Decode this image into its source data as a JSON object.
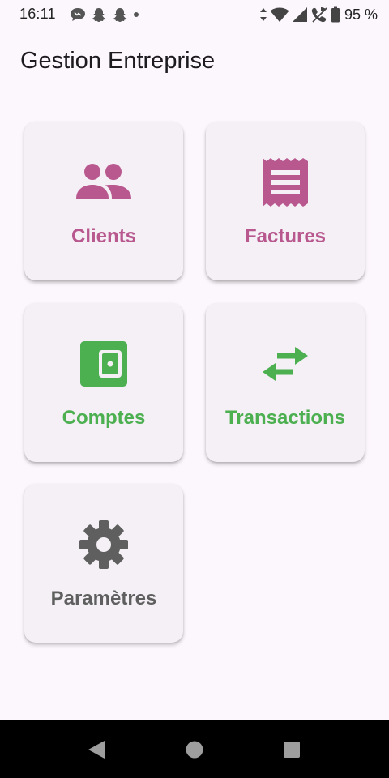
{
  "status_bar": {
    "time": "16:11",
    "battery": "95 %",
    "left_icons": [
      "chat-bubble-icon",
      "snapchat-ghost-icon",
      "snapchat-ghost-icon",
      "dot-icon"
    ],
    "right_icons": [
      "data-arrows-icon",
      "wifi-icon",
      "signal-icon",
      "wifi-calling-icon",
      "battery-icon"
    ]
  },
  "app": {
    "title": "Gestion Entreprise"
  },
  "cards": [
    {
      "label": "Clients",
      "icon": "people-icon",
      "color": "#b8588f"
    },
    {
      "label": "Factures",
      "icon": "receipt-icon",
      "color": "#b8588f"
    },
    {
      "label": "Comptes",
      "icon": "wallet-icon",
      "color": "#4caf50"
    },
    {
      "label": "Transactions",
      "icon": "swap-horizontal-icon",
      "color": "#4caf50"
    },
    {
      "label": "Paramètres",
      "icon": "settings-gear-icon",
      "color": "#5f5f5f"
    }
  ],
  "nav_bar": {
    "buttons": [
      "back-triangle-icon",
      "home-circle-icon",
      "recent-square-icon"
    ]
  }
}
